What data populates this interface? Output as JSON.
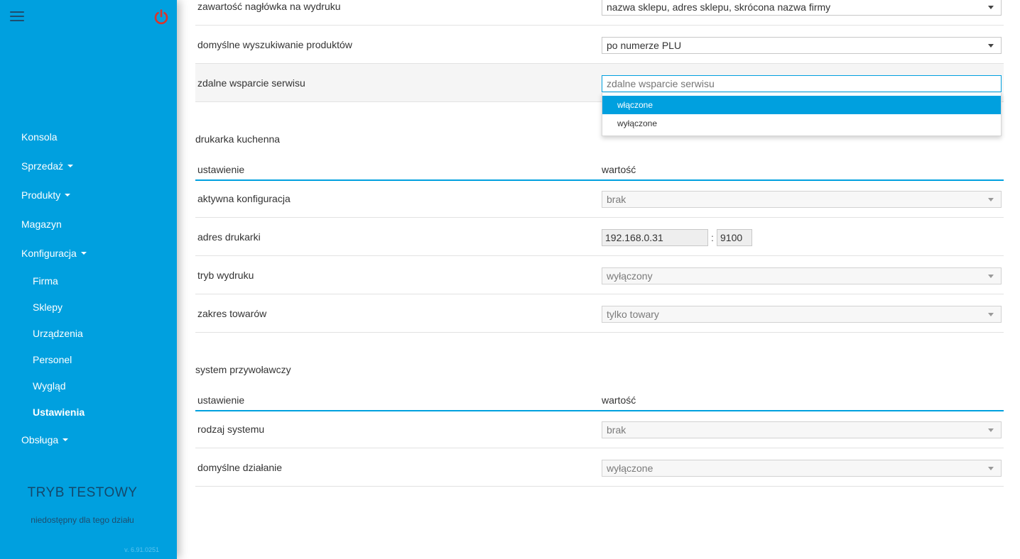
{
  "sidebar": {
    "nav": {
      "konsola": "Konsola",
      "sprzedaz": "Sprzedaż",
      "produkty": "Produkty",
      "magazyn": "Magazyn",
      "konfiguracja": "Konfiguracja",
      "firma": "Firma",
      "sklepy": "Sklepy",
      "urzadzenia": "Urządzenia",
      "personel": "Personel",
      "wyglad": "Wygląd",
      "ustawienia": "Ustawienia",
      "obsluga": "Obsługa"
    },
    "test_mode": "TRYB TESTOWY",
    "test_mode_sub": "niedostępny dla tego działu",
    "version": "v. 6.91.0251"
  },
  "top_rows": {
    "header_content": {
      "label": "zawartość nagłówka na wydruku",
      "value": "nazwa sklepu, adres sklepu, skrócona nazwa firmy"
    },
    "default_search": {
      "label": "domyślne wyszukiwanie produktów",
      "value": "po numerze PLU"
    },
    "remote_support": {
      "label": "zdalne wsparcie serwisu",
      "placeholder": "zdalne wsparcie serwisu",
      "options": [
        "włączone",
        "wyłączone"
      ]
    }
  },
  "kitchen_printer": {
    "title": "drukarka kuchenna",
    "col_setting": "ustawienie",
    "col_value": "wartość",
    "active_config": {
      "label": "aktywna konfiguracja",
      "value": "brak"
    },
    "printer_address": {
      "label": "adres drukarki",
      "ip": "192.168.0.31",
      "separator": ":",
      "port": "9100"
    },
    "print_mode": {
      "label": "tryb wydruku",
      "value": "wyłączony"
    },
    "product_range": {
      "label": "zakres towarów",
      "value": "tylko towary"
    }
  },
  "call_system": {
    "title": "system przywoławczy",
    "col_setting": "ustawienie",
    "col_value": "wartość",
    "system_type": {
      "label": "rodzaj systemu",
      "value": "brak"
    },
    "default_action": {
      "label": "domyślne działanie",
      "value": "wyłączone"
    }
  },
  "colors": {
    "sidebar_bg": "#00a0df",
    "accent": "#00a0df",
    "power_icon": "#d9342b"
  }
}
